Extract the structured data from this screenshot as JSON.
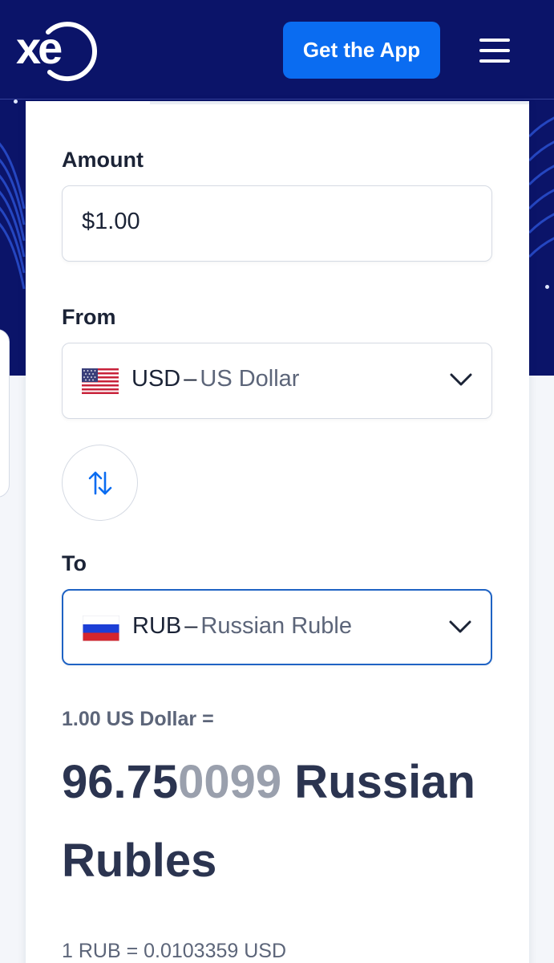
{
  "header": {
    "logo_text": "xe",
    "get_app_label": "Get the App"
  },
  "converter": {
    "amount_label": "Amount",
    "amount_value": "$1.00",
    "from_label": "From",
    "from_code": "USD",
    "from_name": "US Dollar",
    "to_label": "To",
    "to_code": "RUB",
    "to_name": "Russian Ruble",
    "separator": "–"
  },
  "result": {
    "rate_from": "1.00 US Dollar =",
    "value_main": "96.75",
    "value_faded": "0099",
    "value_unit": " Russian Rubles",
    "inverse_rate": "1 RUB = 0.0103359 USD"
  },
  "colors": {
    "header_bg": "#0b1469",
    "accent": "#0a6cf1",
    "active_border": "#1f63c4"
  },
  "icons": {
    "menu": "hamburger-menu-icon",
    "swap": "swap-arrows-icon",
    "dropdown": "chevron-down-icon",
    "from_flag": "us-flag-icon",
    "to_flag": "russia-flag-icon"
  }
}
